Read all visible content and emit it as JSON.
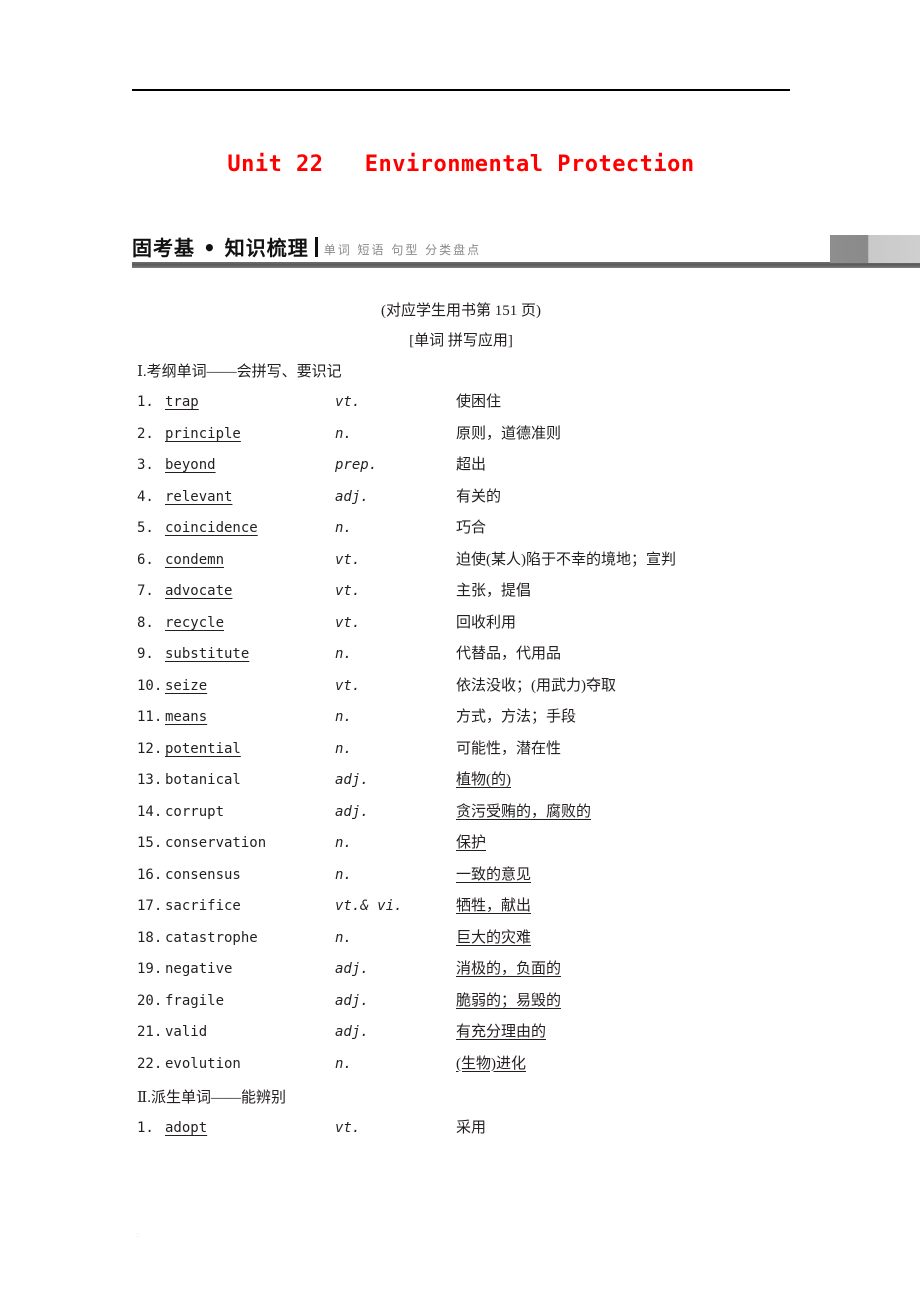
{
  "document": {
    "unit_title": "Unit 22   Environmental Protection",
    "title_color": "#ff0000",
    "banner": {
      "title": "固考基 • 知识梳理",
      "subtitle": "单词 短语 句型 分类盘点"
    },
    "notes": {
      "page_ref": "(对应学生用书第 151 页)",
      "subsection": "[单词  拼写应用]"
    },
    "sections": [
      {
        "heading": "Ⅰ.考纲单词——会拼写、要识记",
        "items": [
          {
            "num": "1.",
            "term": "trap",
            "pos": "vt.",
            "meaning": "使困住",
            "underline": "term"
          },
          {
            "num": "2.",
            "term": "principle",
            "pos": "n.",
            "meaning": "原则，道德准则",
            "underline": "term"
          },
          {
            "num": "3.",
            "term": "beyond",
            "pos": "prep.",
            "meaning": "超出",
            "underline": "term"
          },
          {
            "num": "4.",
            "term": "relevant",
            "pos": "adj.",
            "meaning": "有关的",
            "underline": "term"
          },
          {
            "num": "5.",
            "term": "coincidence",
            "pos": "n.",
            "meaning": "巧合",
            "underline": "term"
          },
          {
            "num": "6.",
            "term": "condemn",
            "pos": "vt.",
            "meaning": "迫使(某人)陷于不幸的境地；宣判",
            "underline": "term"
          },
          {
            "num": "7.",
            "term": "advocate",
            "pos": "vt.",
            "meaning": "主张，提倡",
            "underline": "term"
          },
          {
            "num": "8.",
            "term": "recycle",
            "pos": "vt.",
            "meaning": "回收利用",
            "underline": "term"
          },
          {
            "num": "9.",
            "term": "substitute",
            "pos": "n.",
            "meaning": "代替品，代用品",
            "underline": "term"
          },
          {
            "num": "10.",
            "term": "seize",
            "pos": "vt.",
            "meaning": "依法没收；(用武力)夺取",
            "underline": "term"
          },
          {
            "num": "11.",
            "term": "means",
            "pos": "n.",
            "meaning": "方式，方法；手段",
            "underline": "term"
          },
          {
            "num": "12.",
            "term": "potential",
            "pos": "n.",
            "meaning": "可能性，潜在性",
            "underline": "term"
          },
          {
            "num": "13.",
            "term": "botanical",
            "pos": "adj.",
            "meaning": "植物(的)",
            "underline": "meaning"
          },
          {
            "num": "14.",
            "term": "corrupt",
            "pos": "adj.",
            "meaning": "贪污受贿的，腐败的",
            "underline": "meaning"
          },
          {
            "num": "15.",
            "term": "conservation",
            "pos": "n.",
            "meaning": "保护",
            "underline": "meaning"
          },
          {
            "num": "16.",
            "term": "consensus",
            "pos": "n.",
            "meaning": "一致的意见",
            "underline": "meaning"
          },
          {
            "num": "17.",
            "term": "sacrifice",
            "pos": "vt.& vi.",
            "meaning": "牺牲，献出",
            "underline": "meaning"
          },
          {
            "num": "18.",
            "term": "catastrophe",
            "pos": "n.",
            "meaning": "巨大的灾难",
            "underline": "meaning"
          },
          {
            "num": "19.",
            "term": "negative",
            "pos": "adj.",
            "meaning": "消极的，负面的",
            "underline": "meaning"
          },
          {
            "num": "20.",
            "term": "fragile",
            "pos": "adj.",
            "meaning": "脆弱的；易毁的",
            "underline": "meaning"
          },
          {
            "num": "21.",
            "term": "valid",
            "pos": "adj.",
            "meaning": "有充分理由的",
            "underline": "meaning"
          },
          {
            "num": "22.",
            "term": "evolution",
            "pos": "n.",
            "meaning": "(生物)进化",
            "underline": "meaning"
          }
        ]
      },
      {
        "heading": "Ⅱ.派生单词——能辨别",
        "items": [
          {
            "num": "1.",
            "term": "adopt",
            "pos": "vt.",
            "meaning": "采用",
            "underline": "term"
          }
        ]
      }
    ]
  }
}
